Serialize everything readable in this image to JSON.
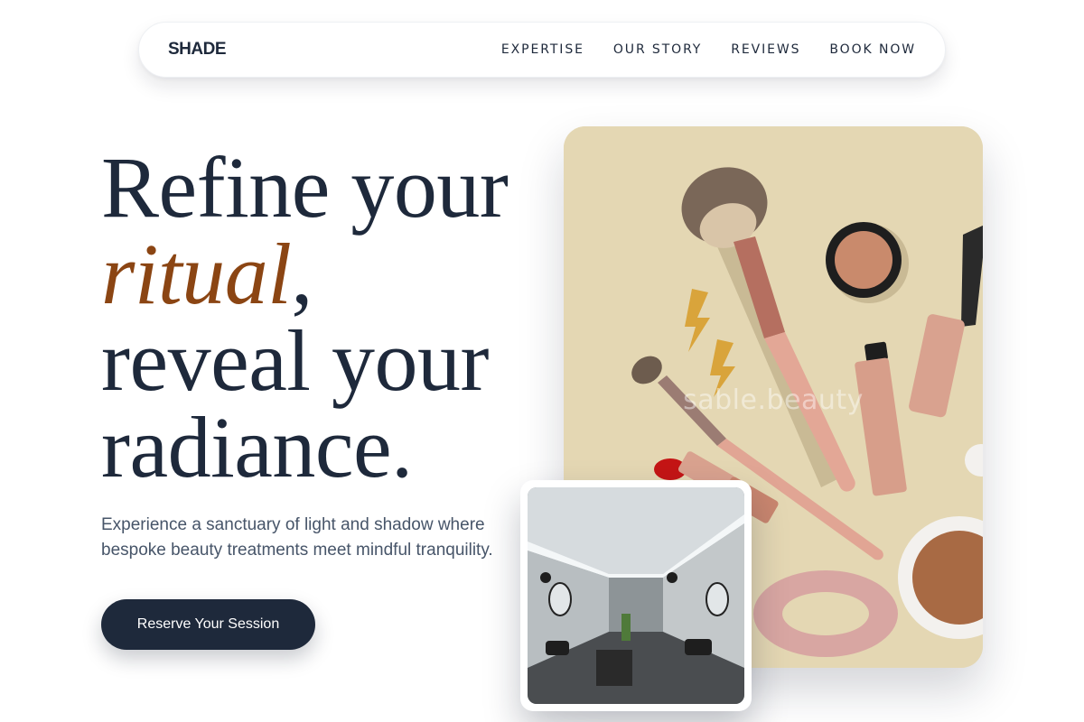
{
  "nav": {
    "logo": "SHADE",
    "links": [
      {
        "label": "EXPERTISE"
      },
      {
        "label": "OUR STORY"
      },
      {
        "label": "REVIEWS"
      },
      {
        "label": "BOOK NOW"
      }
    ]
  },
  "hero": {
    "headline": {
      "line1": "Refine your",
      "accent_word": "ritual",
      "accent_suffix": ",",
      "line3": "reveal your",
      "line4": "radiance."
    },
    "subtext": "Experience a sanctuary of light and shadow where bespoke beauty treatments meet mindful tranquility.",
    "cta_label": "Reserve Your Session"
  },
  "images": {
    "main": {
      "watermark": "sable.beauty",
      "subject": "makeup-flatlay"
    },
    "secondary": {
      "subject": "salon-interior"
    }
  },
  "colors": {
    "navy": "#1e293b",
    "accent_brown": "#8b4513",
    "body_text": "#475569",
    "beige_background": "#e4d7b3"
  }
}
